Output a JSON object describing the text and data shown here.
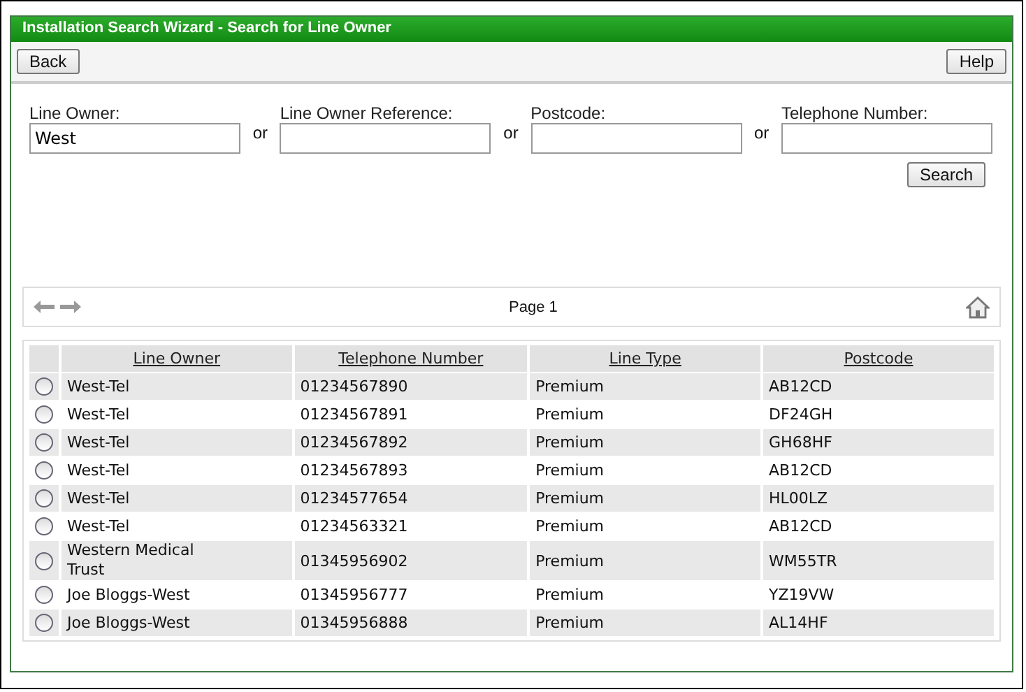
{
  "window": {
    "title": "Installation Search Wizard - Search for Line Owner"
  },
  "toolbar": {
    "back": "Back",
    "help": "Help"
  },
  "search": {
    "fields": [
      {
        "label": "Line Owner:",
        "value": "West"
      },
      {
        "label": "Line Owner Reference:"
      },
      {
        "label": "Postcode:"
      },
      {
        "label": "Telephone Number:"
      }
    ],
    "separators": [
      "or",
      "or",
      "or"
    ],
    "button": "Search"
  },
  "pager": {
    "page": "Page 1"
  },
  "table": {
    "columns": [
      "Line Owner",
      "Telephone Number",
      "Line Type",
      "Postcode"
    ],
    "rows": [
      {
        "selected": false,
        "cells": [
          "West-Tel",
          "01234567890",
          "Premium",
          "AB12CD"
        ]
      },
      {
        "selected": false,
        "cells": [
          "West-Tel",
          "01234567891",
          "Premium",
          "DF24GH"
        ]
      },
      {
        "selected": false,
        "cells": [
          "West-Tel",
          "01234567892",
          "Premium",
          "GH68HF"
        ]
      },
      {
        "selected": false,
        "cells": [
          "West-Tel",
          "01234567893",
          "Premium",
          "AB12CD"
        ]
      },
      {
        "selected": false,
        "cells": [
          "West-Tel",
          "01234577654",
          "Premium",
          "HL00LZ"
        ]
      },
      {
        "selected": false,
        "cells": [
          "West-Tel",
          "01234563321",
          "Premium",
          "AB12CD"
        ]
      },
      {
        "selected": false,
        "cells": [
          "Western Medical Trust",
          "01345956902",
          "Premium",
          "WM55TR"
        ]
      },
      {
        "selected": false,
        "cells": [
          "Joe Bloggs-West",
          "01345956777",
          "Premium",
          "YZ19VW"
        ]
      },
      {
        "selected": false,
        "cells": [
          "Joe Bloggs-West",
          "01345956888",
          "Premium",
          "AL14HF"
        ]
      }
    ]
  }
}
